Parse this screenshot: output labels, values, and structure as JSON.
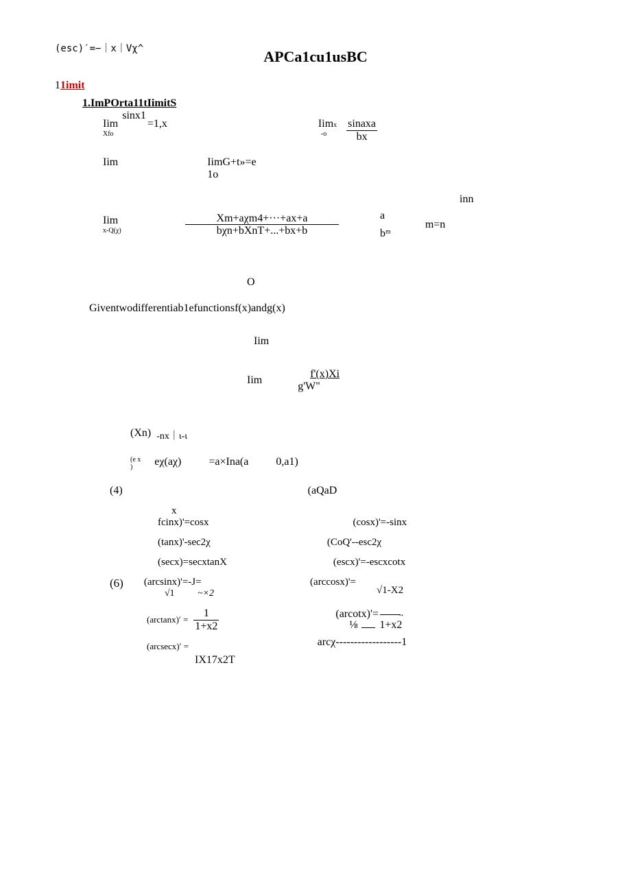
{
  "esc_note": "(esc)′=−｜x｜Vχ^",
  "title": "APCa1cu1usBC",
  "section1_prefix": "1",
  "section1_label": "1imit",
  "subsection1_prefix": "1.",
  "subsection1_label": "ImPOrta11tIimitS",
  "lim_label": "Iim",
  "row1": {
    "left_top": "sinx1",
    "left_eq": "=1,x",
    "left_sub": "Xfo",
    "right_pre": "Iim",
    "right_pre_sub": "x",
    "right_sub2": "-o",
    "frac_num": "sinaxa",
    "frac_den": "bx"
  },
  "row2": {
    "left": "Iim",
    "mid1": "IimG+t»=e",
    "mid2": "1o"
  },
  "row3": {
    "inn": "inn",
    "left": "Iim",
    "left_sub": "x-Q(χ)",
    "frac_num": "Xm+aχm4+···+ax+a",
    "frac_den": "bχn+bXnT+...+bx+b",
    "col_a_top": "a",
    "col_a_bot": "bᵐ",
    "m_n": "m=n"
  },
  "O": "O",
  "given": "Giventwodifferentiab1efunctionsf(x)andg(x)",
  "lim_alone": "Iim",
  "lim_frac": {
    "pre": "Iim",
    "num": "f'(x)Xi",
    "den": "g'W\""
  },
  "d1": {
    "xn": "(Xn)",
    "nx": "-nx｜ι-ι"
  },
  "d2": {
    "ex": "(e x\n)",
    "echi": "eχ(aχ)",
    "eq": "=a×Ina(a",
    "tail": "0,a1)"
  },
  "d4": {
    "label": "(4)",
    "right": "(aQaD",
    "x": "x",
    "sin": "fcinx)'=cosx",
    "cos": "(cosx)'=-sinx",
    "tan": "(tanx)'-sec2χ",
    "cot": "(CoQ'--esc2χ",
    "sec": "(secx)=secxtanX",
    "csc": "(escx)'=-escxcotx"
  },
  "d6": {
    "label": "(6)",
    "arcsin": "(arcsinx)'=-J=",
    "arcsin_b1": "√1",
    "arcsin_b2": "~×2",
    "arccos": "(arccosx)'=",
    "arccos_r": "√1-X2",
    "arctan_pre": "(arctanx)′ =",
    "arctan_num": "1",
    "arctan_den": "1+x2",
    "arccot": "(arcotx)'=",
    "arccot_frac": "⅛",
    "arccot_r": "1+x2",
    "arcsec": "(arcsecx)′ =",
    "arcsec_r": "IX17x2T",
    "arccsc": "arcχ------------------1"
  }
}
